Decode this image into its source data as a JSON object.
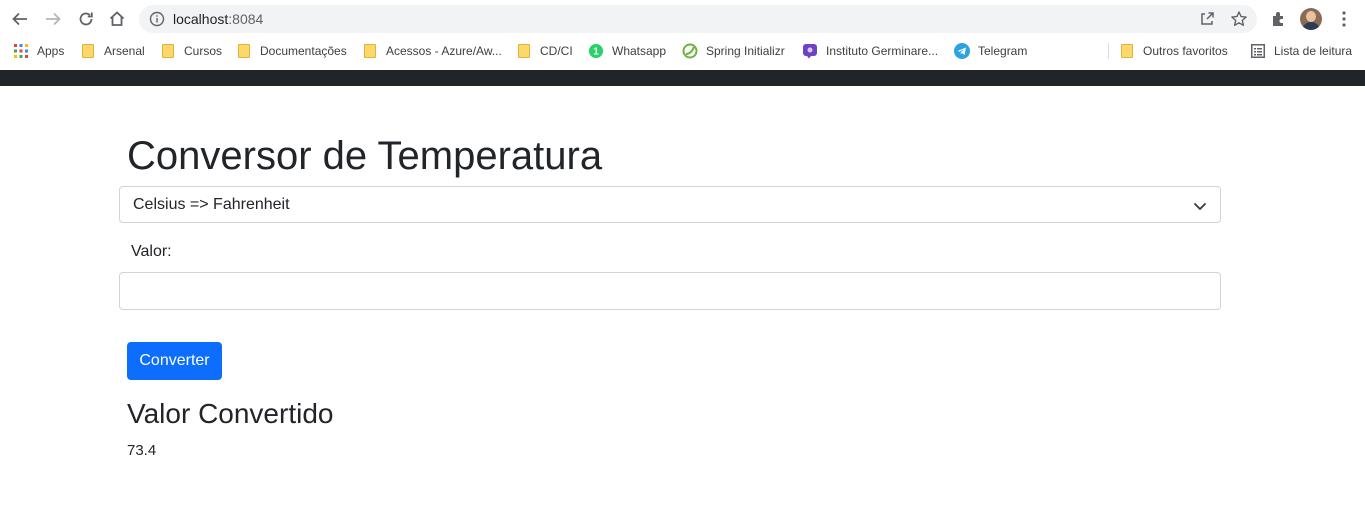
{
  "browser": {
    "url_host": "localhost",
    "url_port": ":8084",
    "bookmarks": [
      {
        "label": "Apps",
        "icon": "apps-grid-icon"
      },
      {
        "label": "Arsenal",
        "icon": "folder-icon"
      },
      {
        "label": "Cursos",
        "icon": "folder-icon"
      },
      {
        "label": "Documentações",
        "icon": "folder-icon"
      },
      {
        "label": "Acessos - Azure/Aw...",
        "icon": "folder-icon"
      },
      {
        "label": "CD/CI",
        "icon": "folder-icon"
      },
      {
        "label": "Whatsapp",
        "icon": "whatsapp-icon"
      },
      {
        "label": "Spring Initializr",
        "icon": "spring-icon"
      },
      {
        "label": "Instituto Germinare...",
        "icon": "germinare-icon"
      },
      {
        "label": "Telegram",
        "icon": "telegram-icon"
      },
      {
        "label": "Outros favoritos",
        "icon": "folder-icon"
      },
      {
        "label": "Lista de leitura",
        "icon": "reading-list-icon"
      }
    ]
  },
  "page": {
    "title": "Conversor de Temperatura",
    "conversion_select": {
      "selected": "Celsius => Fahrenheit"
    },
    "value_label": "Valor:",
    "value_input": {
      "value": "",
      "placeholder": ""
    },
    "convert_button": "Converter",
    "result_title": "Valor Convertido",
    "result_value": "73.4"
  },
  "colors": {
    "primary_button": "#0d6efd",
    "navbar": "#212529"
  }
}
